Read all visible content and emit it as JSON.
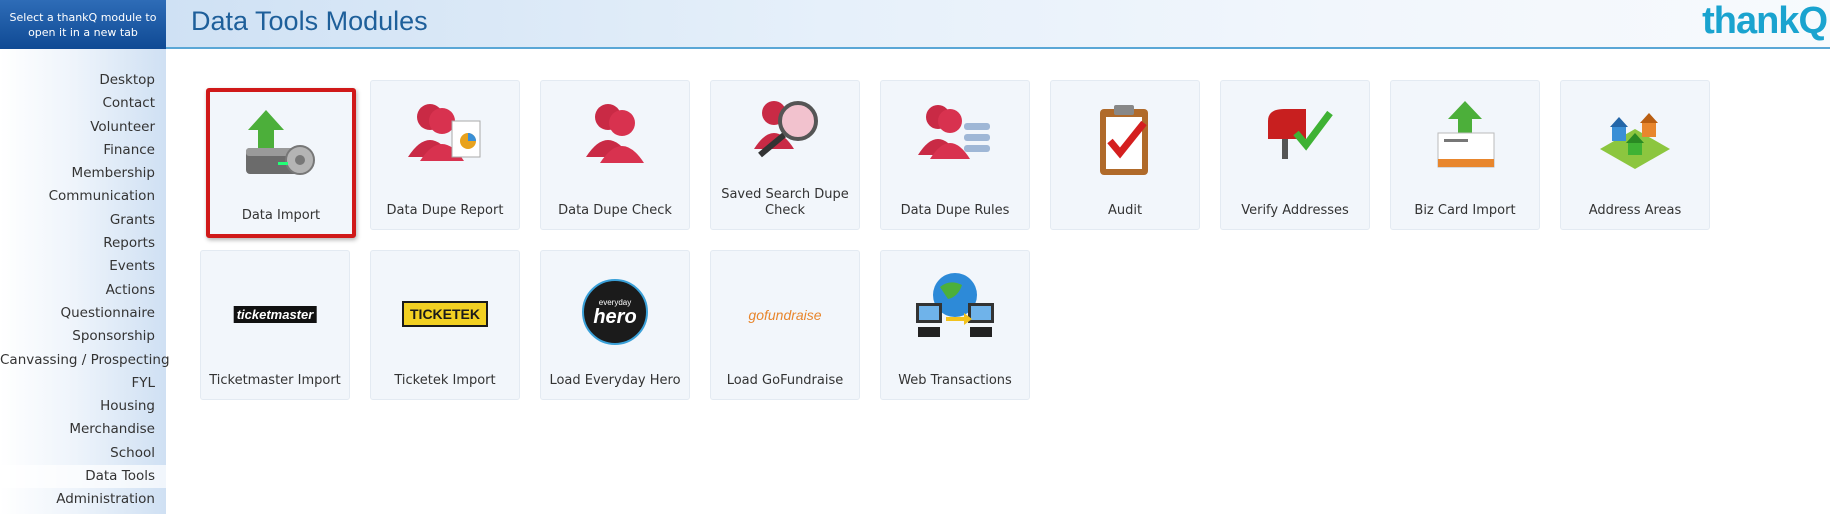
{
  "sidebar": {
    "hint": "Select a thankQ module to open it in a new tab",
    "items": [
      {
        "label": "Desktop"
      },
      {
        "label": "Contact"
      },
      {
        "label": "Volunteer"
      },
      {
        "label": "Finance"
      },
      {
        "label": "Membership"
      },
      {
        "label": "Communication"
      },
      {
        "label": "Grants"
      },
      {
        "label": "Reports"
      },
      {
        "label": "Events"
      },
      {
        "label": "Actions"
      },
      {
        "label": "Questionnaire"
      },
      {
        "label": "Sponsorship"
      },
      {
        "label": "Canvassing / Prospecting"
      },
      {
        "label": "FYL"
      },
      {
        "label": "Housing"
      },
      {
        "label": "Merchandise"
      },
      {
        "label": "School"
      },
      {
        "label": "Data Tools"
      },
      {
        "label": "Administration"
      }
    ],
    "active": "Data Tools"
  },
  "header": {
    "title": "Data Tools Modules",
    "logo": "thankQ"
  },
  "tiles": [
    {
      "label": "Data Import",
      "icon": "data-import-icon",
      "selected": true
    },
    {
      "label": "Data Dupe Report",
      "icon": "dupe-report-icon"
    },
    {
      "label": "Data Dupe Check",
      "icon": "dupe-check-icon"
    },
    {
      "label": "Saved Search Dupe Check",
      "icon": "search-dupe-icon"
    },
    {
      "label": "Data Dupe Rules",
      "icon": "dupe-rules-icon"
    },
    {
      "label": "Audit",
      "icon": "clipboard-check-icon"
    },
    {
      "label": "Verify Addresses",
      "icon": "mailbox-icon"
    },
    {
      "label": "Biz Card Import",
      "icon": "biz-card-icon"
    },
    {
      "label": "Address Areas",
      "icon": "houses-map-icon"
    },
    {
      "label": "Ticketmaster Import",
      "icon": "ticketmaster-logo",
      "logo_text": "ticketmaster"
    },
    {
      "label": "Ticketek Import",
      "icon": "ticketek-logo",
      "logo_text": "TICKETEK"
    },
    {
      "label": "Load Everyday Hero",
      "icon": "everyday-hero-logo",
      "logo_small": "everyday",
      "logo_big": "hero"
    },
    {
      "label": "Load GoFundraise",
      "icon": "gofundraise-logo",
      "logo_text": "gofundraise"
    },
    {
      "label": "Web Transactions",
      "icon": "globe-computers-icon"
    }
  ],
  "colors": {
    "accent": "#1e5f9a",
    "logo": "#1aa3cf",
    "selected_border": "#d01919",
    "person_red": "#d8324f"
  }
}
